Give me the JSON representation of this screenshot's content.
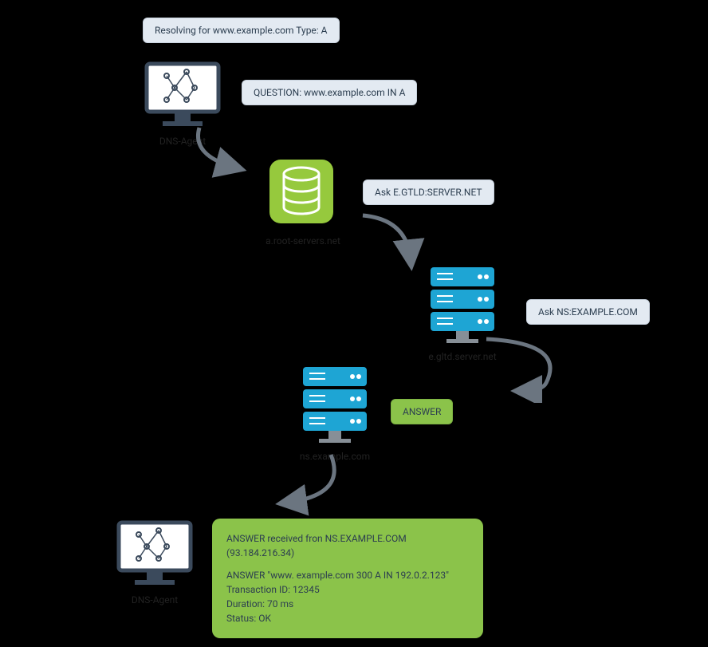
{
  "bubbles": {
    "resolving": "Resolving for www.example.com  Type: A",
    "question": "QUESTION: www.example.com IN A",
    "ask_gtld": "Ask E.GTLD:SERVER.NET",
    "ask_ns": "Ask NS:EXAMPLE.COM",
    "answer": "ANSWER"
  },
  "labels": {
    "agent_top": "DNS-Agent",
    "root": "a.root-servers.net",
    "gtld": "e.gltd.server.net",
    "ns": "ns.example.com",
    "agent_bottom": "DNS-Agent"
  },
  "answer_box": {
    "line1": "ANSWER received fron NS.EXAMPLE.COM (93.184.216.34)",
    "line2": "ANSWER \"www. example.com 300 A IN 192.0.2.123\"",
    "line3": "Transaction ID: 12345",
    "line4": "Duration: 70 ms",
    "line5": "Status: OK"
  }
}
